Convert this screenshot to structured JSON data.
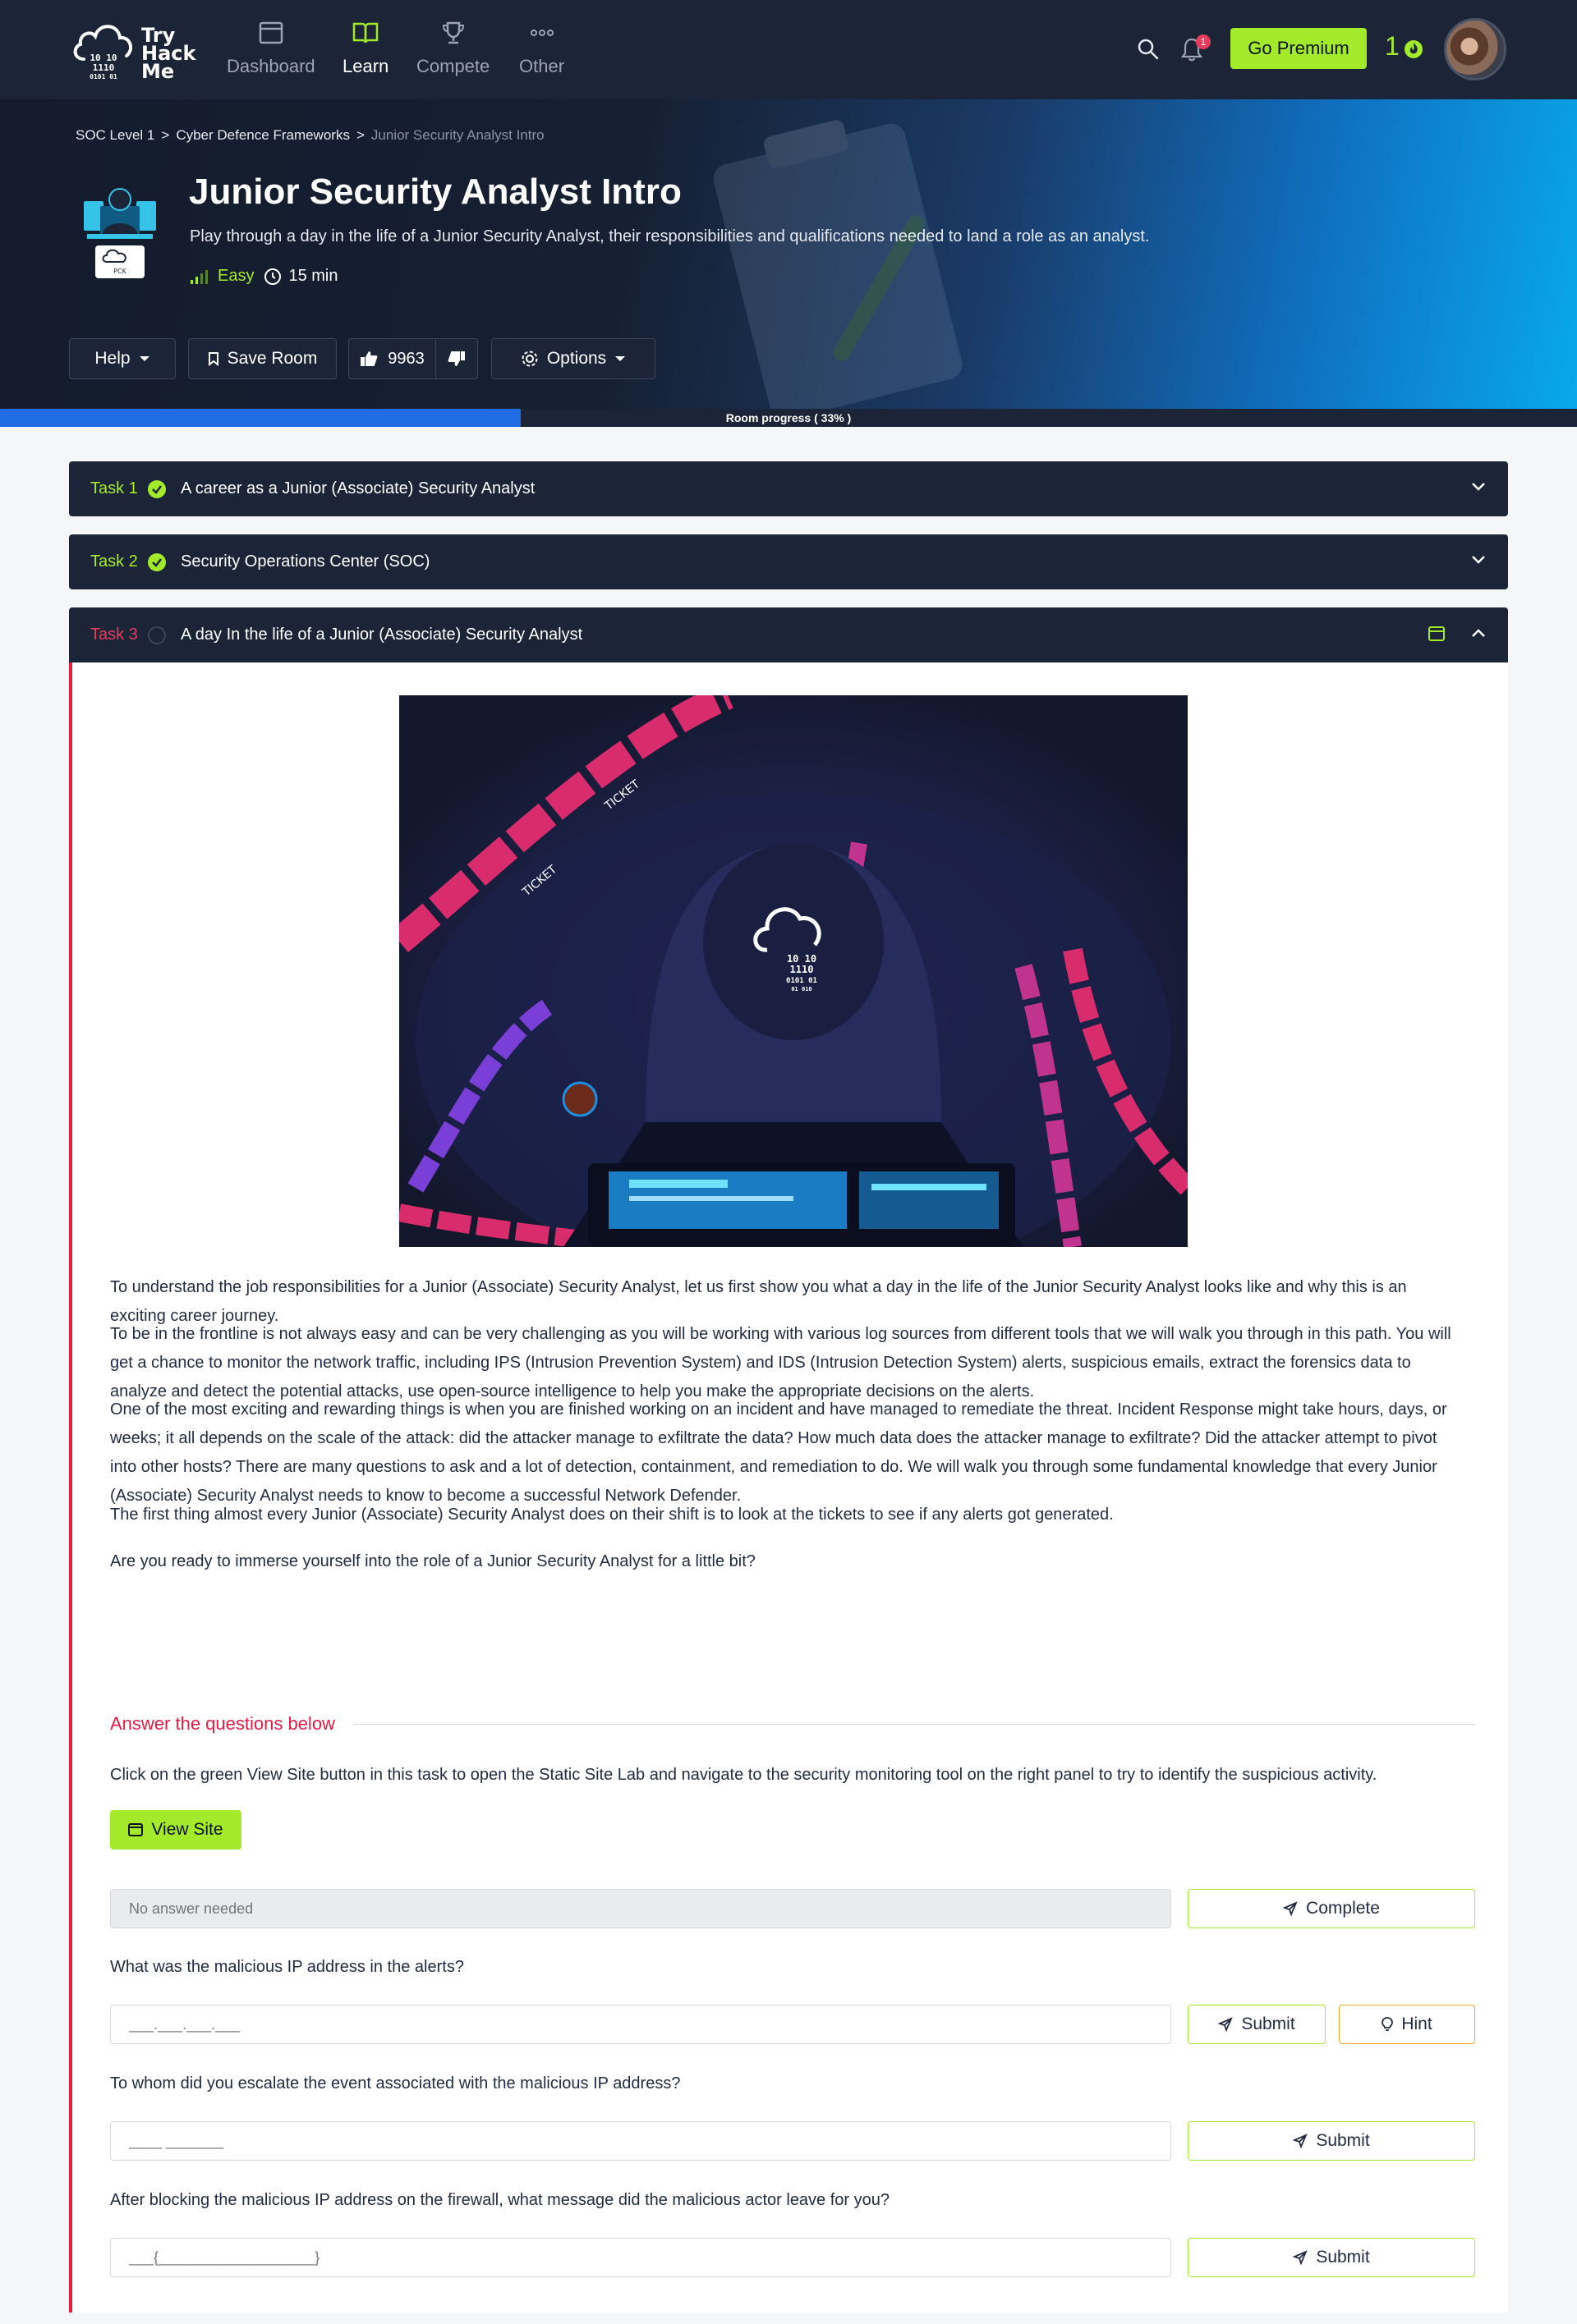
{
  "nav": {
    "logo_lines": [
      "Try",
      "Hack",
      "Me"
    ],
    "items": [
      {
        "label": "Dashboard",
        "icon": "browser-window-icon",
        "active": false
      },
      {
        "label": "Learn",
        "icon": "book-icon",
        "active": true
      },
      {
        "label": "Compete",
        "icon": "trophy-icon",
        "active": false
      },
      {
        "label": "Other",
        "icon": "more-dots-icon",
        "active": false
      }
    ],
    "notification_count": "1",
    "premium_label": "Go Premium",
    "streak_count": "1",
    "accent_color": "#a3ea2a"
  },
  "hero": {
    "breadcrumb": [
      "SOC Level 1",
      "Cyber Defence Frameworks",
      "Junior Security Analyst Intro"
    ],
    "breadcrumb_sep": ">",
    "title": "Junior Security Analyst Intro",
    "description": "Play through a day in the life of a Junior Security Analyst, their responsibilities and qualifications needed to land a role as an analyst.",
    "difficulty": "Easy",
    "duration": "15 min",
    "help_label": "Help",
    "save_label": "Save Room",
    "likes": "9963",
    "options_label": "Options"
  },
  "progress": {
    "label": "Room progress ( 33% )",
    "percent": 33
  },
  "tasks": [
    {
      "num": "Task 1",
      "title": "A career as a Junior (Associate) Security Analyst",
      "done": true
    },
    {
      "num": "Task 2",
      "title": "Security Operations Center (SOC)",
      "done": true
    },
    {
      "num": "Task 3",
      "title": "A day In the life of a Junior (Associate) Security Analyst",
      "done": false
    }
  ],
  "task3": {
    "image_logo_lines": [
      "10 10",
      "1110",
      "0101 01",
      "01 010"
    ],
    "image_ticket_text": "TICKET",
    "paragraphs": [
      "To understand the job responsibilities for a Junior (Associate) Security Analyst, let us first show you what a day in the life of the Junior Security Analyst looks like and why this is an exciting career journey.",
      "To be in the frontline is not always easy and can be very challenging as you will be working with various log sources from different tools that we will walk you through in this path. You will get a chance to monitor the network traffic, including IPS (Intrusion Prevention System) and IDS (Intrusion Detection System) alerts, suspicious emails, extract the forensics data to analyze and detect the potential attacks, use open-source intelligence to help you make the appropriate decisions on the alerts.",
      "One of the most exciting and rewarding things is when you are finished working on an incident and have managed to remediate the threat. Incident Response might take hours, days, or weeks; it all depends on the scale of the attack: did the attacker manage to exfiltrate the data? How much data does the attacker manage to exfiltrate? Did the attacker attempt to pivot into other hosts? There are many questions to ask and a lot of detection, containment, and remediation to do. We will walk you through some fundamental knowledge that every Junior (Associate) Security Analyst needs to know to become a successful Network Defender.",
      "The first thing almost every Junior (Associate) Security Analyst does on their shift is to look at the tickets to see if any alerts got generated.",
      "Are you ready to immerse yourself into the role of a Junior Security Analyst for a little bit?"
    ],
    "answer_heading": "Answer the questions below",
    "instruction": "Click on the green View Site button in this task to open the Static Site Lab and navigate to the security monitoring tool on the right panel to try to identify the suspicious activity.",
    "view_site_label": "View Site",
    "no_answer_placeholder": "No answer needed",
    "complete_label": "Complete",
    "questions": [
      {
        "text": "What was the malicious IP address in the alerts?",
        "placeholder": "___.___.___.___",
        "submit": "Submit",
        "hint": "Hint"
      },
      {
        "text": "To whom did you escalate the event associated with the malicious IP address?",
        "placeholder": "____ _______",
        "submit": "Submit"
      },
      {
        "text": "After blocking the malicious IP address on the firewall, what message did the malicious actor leave for you?",
        "placeholder": "___{___________________}",
        "submit": "Submit"
      }
    ]
  }
}
